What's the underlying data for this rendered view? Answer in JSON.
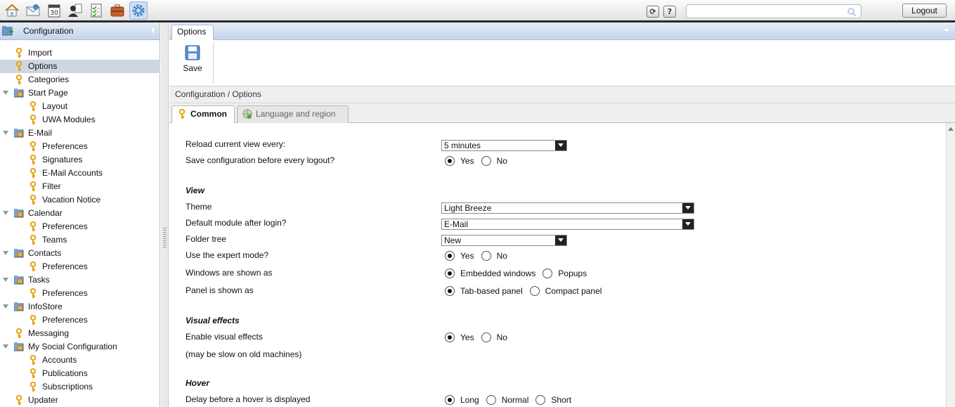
{
  "topbar": {
    "apps": [
      {
        "name": "home-icon"
      },
      {
        "name": "mail-icon"
      },
      {
        "name": "calendar-icon",
        "label": "30"
      },
      {
        "name": "contacts-icon"
      },
      {
        "name": "tasks-icon"
      },
      {
        "name": "infostore-icon"
      },
      {
        "name": "configuration-gear-icon"
      }
    ],
    "search_placeholder": "",
    "logout_label": "Logout"
  },
  "sidebar": {
    "title": "Configuration",
    "items": [
      {
        "label": "Import",
        "level": 1,
        "type": "leaf",
        "selected": false
      },
      {
        "label": "Options",
        "level": 1,
        "type": "leaf",
        "selected": true
      },
      {
        "label": "Categories",
        "level": 1,
        "type": "leaf",
        "selected": false
      },
      {
        "label": "Start Page",
        "level": 1,
        "type": "folder",
        "selected": false
      },
      {
        "label": "Layout",
        "level": 2,
        "type": "leaf",
        "selected": false
      },
      {
        "label": "UWA Modules",
        "level": 2,
        "type": "leaf",
        "selected": false
      },
      {
        "label": "E-Mail",
        "level": 1,
        "type": "folder",
        "selected": false
      },
      {
        "label": "Preferences",
        "level": 2,
        "type": "leaf",
        "selected": false
      },
      {
        "label": "Signatures",
        "level": 2,
        "type": "leaf",
        "selected": false
      },
      {
        "label": "E-Mail Accounts",
        "level": 2,
        "type": "leaf",
        "selected": false
      },
      {
        "label": "Filter",
        "level": 2,
        "type": "leaf",
        "selected": false
      },
      {
        "label": "Vacation Notice",
        "level": 2,
        "type": "leaf",
        "selected": false
      },
      {
        "label": "Calendar",
        "level": 1,
        "type": "folder",
        "selected": false
      },
      {
        "label": "Preferences",
        "level": 2,
        "type": "leaf",
        "selected": false
      },
      {
        "label": "Teams",
        "level": 2,
        "type": "leaf",
        "selected": false
      },
      {
        "label": "Contacts",
        "level": 1,
        "type": "folder",
        "selected": false
      },
      {
        "label": "Preferences",
        "level": 2,
        "type": "leaf",
        "selected": false
      },
      {
        "label": "Tasks",
        "level": 1,
        "type": "folder",
        "selected": false
      },
      {
        "label": "Preferences",
        "level": 2,
        "type": "leaf",
        "selected": false
      },
      {
        "label": "InfoStore",
        "level": 1,
        "type": "folder",
        "selected": false
      },
      {
        "label": "Preferences",
        "level": 2,
        "type": "leaf",
        "selected": false
      },
      {
        "label": "Messaging",
        "level": 1,
        "type": "leaf",
        "selected": false
      },
      {
        "label": "My Social Configuration",
        "level": 1,
        "type": "folder",
        "selected": false
      },
      {
        "label": "Accounts",
        "level": 2,
        "type": "leaf",
        "selected": false
      },
      {
        "label": "Publications",
        "level": 2,
        "type": "leaf",
        "selected": false
      },
      {
        "label": "Subscriptions",
        "level": 2,
        "type": "leaf",
        "selected": false
      },
      {
        "label": "Updater",
        "level": 1,
        "type": "leaf",
        "selected": false
      }
    ]
  },
  "main": {
    "tab_label": "Options",
    "toolbar": {
      "save_label": "Save"
    },
    "breadcrumb": "Configuration / Options",
    "subtabs": [
      {
        "label": "Common",
        "active": true
      },
      {
        "label": "Language and region",
        "active": false
      }
    ],
    "form": {
      "reload": {
        "label": "Reload current view every:",
        "value": "5 minutes"
      },
      "save_config": {
        "label": "Save configuration before every logout?",
        "options": [
          "Yes",
          "No"
        ],
        "selected": 0
      },
      "view_heading": "View",
      "theme": {
        "label": "Theme",
        "value": "Light Breeze"
      },
      "default_module": {
        "label": "Default module after login?",
        "value": "E-Mail"
      },
      "folder_tree": {
        "label": "Folder tree",
        "value": "New"
      },
      "expert_mode": {
        "label": "Use the expert mode?",
        "options": [
          "Yes",
          "No"
        ],
        "selected": 0
      },
      "windows_shown": {
        "label": "Windows are shown as",
        "options": [
          "Embedded windows",
          "Popups"
        ],
        "selected": 0
      },
      "panel_shown": {
        "label": "Panel is shown as",
        "options": [
          "Tab-based panel",
          "Compact panel"
        ],
        "selected": 0
      },
      "visual_heading": "Visual effects",
      "visual_effects": {
        "label": "Enable visual effects",
        "options": [
          "Yes",
          "No"
        ],
        "selected": 0
      },
      "visual_note": "(may be slow on old machines)",
      "hover_heading": "Hover",
      "hover_delay": {
        "label": "Delay before a hover is displayed",
        "options": [
          "Long",
          "Normal",
          "Short"
        ],
        "selected": 0
      }
    }
  },
  "colors": {
    "header_gradient_top": "#e4ecf7",
    "header_gradient_bottom": "#c6d5ea",
    "selected_row": "#cfd6e2",
    "key_icon": "#e8a317",
    "topbar_border": "#2b2b2b"
  }
}
